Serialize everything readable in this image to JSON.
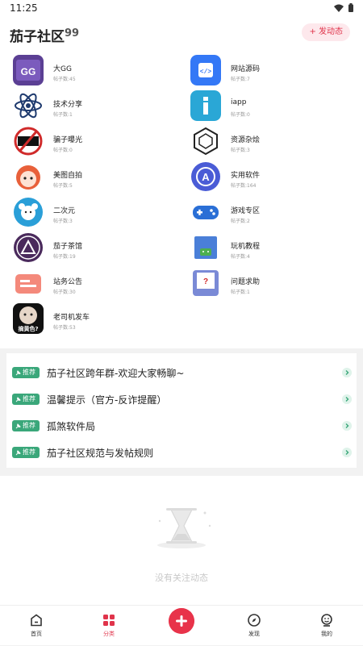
{
  "status": {
    "time": "11:25"
  },
  "header": {
    "title": "茄子社区",
    "quote_mark": "99",
    "post_button": "+ 发动态"
  },
  "categories": [
    {
      "name": "大GG",
      "count": "帖子数:45",
      "icon": "gg-game-icon"
    },
    {
      "name": "网站源码",
      "count": "帖子数:7",
      "icon": "code-icon"
    },
    {
      "name": "技术分享",
      "count": "帖子数:1",
      "icon": "atom-icon"
    },
    {
      "name": "iapp",
      "count": "帖子数:0",
      "icon": "iapp-icon"
    },
    {
      "name": "骗子曝光",
      "count": "帖子数:0",
      "icon": "scam-stamp-icon"
    },
    {
      "name": "资源杂烩",
      "count": "帖子数:3",
      "icon": "hexagon-icon"
    },
    {
      "name": "美图自拍",
      "count": "帖子数:5",
      "icon": "anime-girl-icon"
    },
    {
      "name": "实用软件",
      "count": "帖子数:164",
      "icon": "app-store-icon"
    },
    {
      "name": "二次元",
      "count": "帖子数:3",
      "icon": "bear-icon"
    },
    {
      "name": "游戏专区",
      "count": "帖子数:2",
      "icon": "gamepad-icon"
    },
    {
      "name": "茄子茶馆",
      "count": "帖子数:19",
      "icon": "teahouse-icon"
    },
    {
      "name": "玩机教程",
      "count": "帖子数:4",
      "icon": "android-box-icon"
    },
    {
      "name": "站务公告",
      "count": "帖子数:30",
      "icon": "notice-icon"
    },
    {
      "name": "问题求助",
      "count": "帖子数:1",
      "icon": "help-board-icon"
    },
    {
      "name": "老司机发车",
      "count": "帖子数:53",
      "icon": "meme-face-icon"
    }
  ],
  "notices": [
    {
      "tag": "推荐",
      "text": "茄子社区跨年群-欢迎大家畅聊~"
    },
    {
      "tag": "推荐",
      "text": "温馨提示（官方-反诈提醒）"
    },
    {
      "tag": "推荐",
      "text": "孤煞软件局"
    },
    {
      "tag": "推荐",
      "text": "茄子社区规范与发帖规则"
    }
  ],
  "empty": {
    "text": "没有关注动态",
    "meme_caption": "搞黄色?"
  },
  "tabs": [
    {
      "label": "首页",
      "icon": "home-icon"
    },
    {
      "label": "分类",
      "icon": "category-icon",
      "active": true
    },
    {
      "label": "发现",
      "icon": "compass-icon"
    },
    {
      "label": "我的",
      "icon": "profile-icon"
    }
  ],
  "colors": {
    "accent": "#e0344b",
    "tag_green": "#3aa77a",
    "blue": "#3b82f6"
  }
}
